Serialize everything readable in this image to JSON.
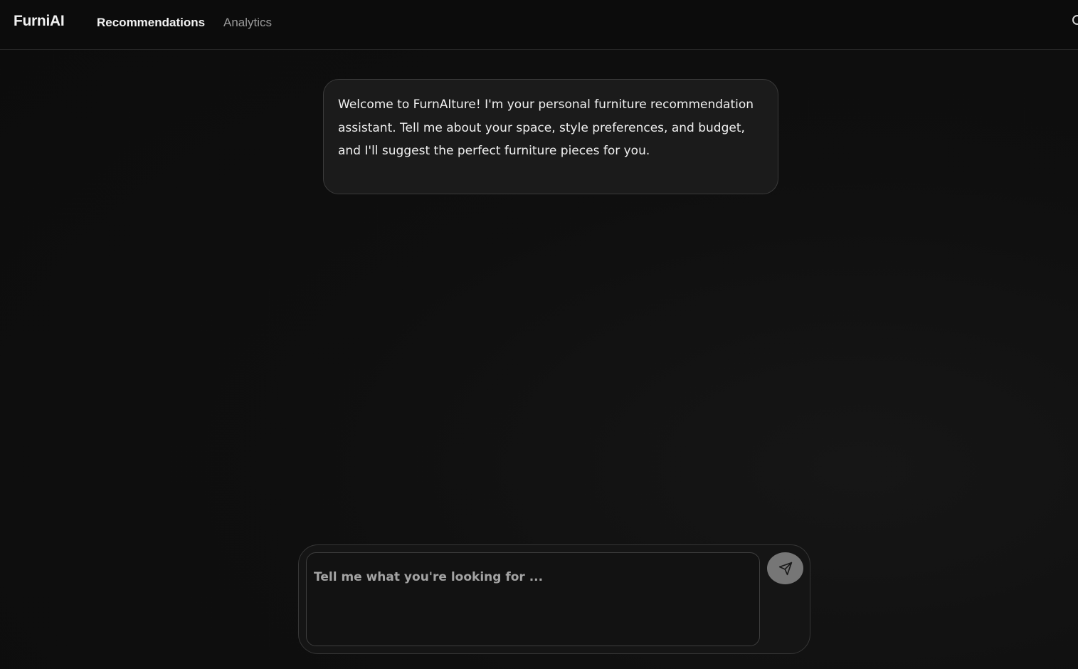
{
  "header": {
    "brand": "FurniAI",
    "nav": [
      {
        "label": "Recommendations",
        "active": true
      },
      {
        "label": "Analytics",
        "active": false
      }
    ]
  },
  "chat": {
    "messages": [
      {
        "role": "assistant",
        "text": "Welcome to FurnAIture! I'm your personal furniture recommendation assistant. Tell me about your space, style preferences, and budget, and I'll suggest the perfect furniture pieces for you."
      }
    ]
  },
  "composer": {
    "placeholder": "Tell me what you're looking for ...",
    "value": "",
    "send_icon": "send-icon"
  },
  "colors": {
    "background": "#0f0f0f",
    "bubble": "#1b1b1b",
    "send_button": "#767676"
  }
}
